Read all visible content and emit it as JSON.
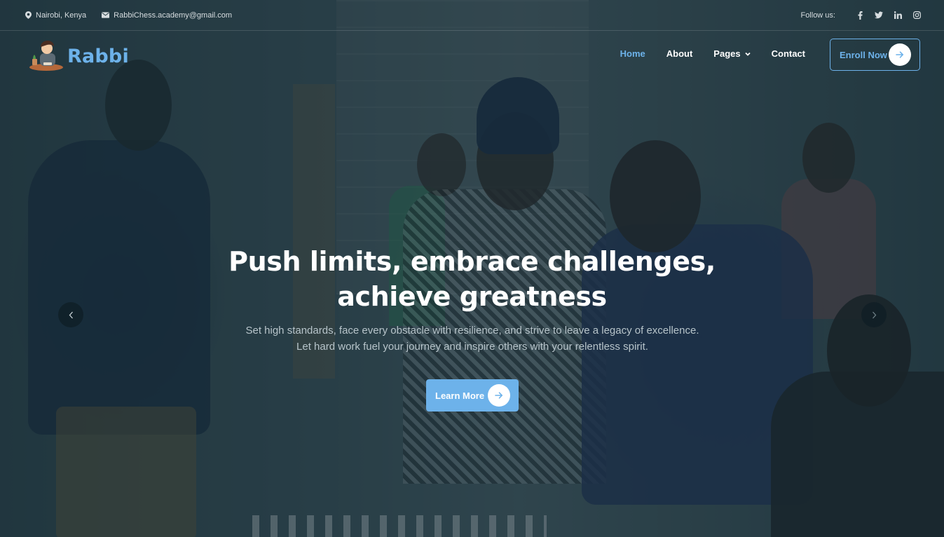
{
  "topbar": {
    "location": "Nairobi, Kenya",
    "email": "RabbiChess.academy@gmail.com",
    "follow_label": "Follow us:",
    "social": [
      "facebook-icon",
      "twitter-icon",
      "linkedin-icon",
      "instagram-icon"
    ]
  },
  "brand": {
    "name": "Rabbi"
  },
  "nav": {
    "items": [
      {
        "label": "Home",
        "active": true
      },
      {
        "label": "About"
      },
      {
        "label": "Pages",
        "dropdown": true
      },
      {
        "label": "Contact"
      }
    ],
    "cta": "Enroll Now"
  },
  "hero": {
    "headline_line1": "Push limits, embrace challenges,",
    "headline_line2": "achieve greatness",
    "subtext": "Set high standards, face every obstacle with resilience, and strive to leave a legacy of excellence. Let hard work fuel your journey and inspire others with your relentless spirit.",
    "button": "Learn More"
  },
  "colors": {
    "accent": "#6db2ea",
    "overlay": "#19323c",
    "text": "#ffffff"
  }
}
